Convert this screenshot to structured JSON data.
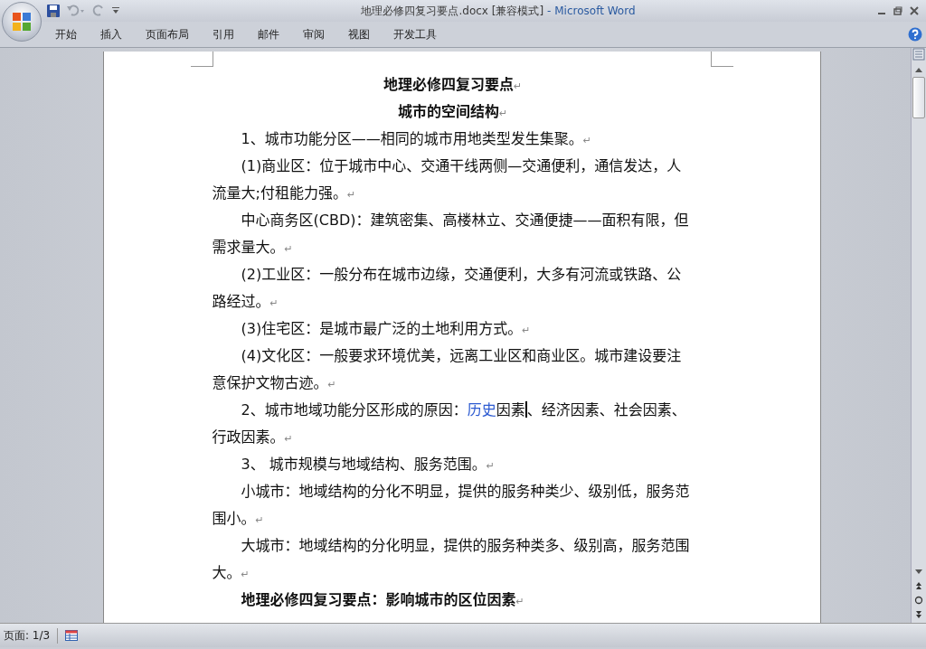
{
  "window": {
    "title": "地理必修四复习要点.docx [兼容模式]",
    "app_name": "- Microsoft Word"
  },
  "ribbon_tabs": [
    {
      "label": "开始",
      "selected": false
    },
    {
      "label": "插入",
      "selected": false
    },
    {
      "label": "页面布局",
      "selected": false
    },
    {
      "label": "引用",
      "selected": false
    },
    {
      "label": "邮件",
      "selected": false
    },
    {
      "label": "审阅",
      "selected": false
    },
    {
      "label": "视图",
      "selected": false
    },
    {
      "label": "开发工具",
      "selected": false
    }
  ],
  "document": {
    "paragraphs": [
      {
        "kind": "heading",
        "mark": "↵",
        "segments": [
          {
            "kind": "plain",
            "text": "地理必修四复习要点"
          }
        ]
      },
      {
        "kind": "heading",
        "mark": "↵",
        "segments": [
          {
            "kind": "plain",
            "text": "城市的空间结构"
          }
        ]
      },
      {
        "kind": "body",
        "mark": "↵",
        "segments": [
          {
            "kind": "plain",
            "text": "1、城市功能分区——相同的城市用地类型发生集聚。"
          }
        ]
      },
      {
        "kind": "body",
        "mark": "↵",
        "segments": [
          {
            "kind": "plain",
            "text": "(1)商业区：位于城市中心、交通干线两侧—交通便利，通信发达，人流量大;付租能力强。"
          }
        ]
      },
      {
        "kind": "body",
        "mark": "↵",
        "segments": [
          {
            "kind": "plain",
            "text": "中心商务区(CBD)：建筑密集、高楼林立、交通便捷——面积有限，但需求量大。"
          }
        ]
      },
      {
        "kind": "body",
        "mark": "↵",
        "segments": [
          {
            "kind": "plain",
            "text": "(2)工业区：一般分布在城市边缘，交通便利，大多有河流或铁路、公路经过。"
          }
        ]
      },
      {
        "kind": "body",
        "mark": "↵",
        "segments": [
          {
            "kind": "plain",
            "text": "(3)住宅区：是城市最广泛的土地利用方式。"
          }
        ]
      },
      {
        "kind": "body",
        "mark": "↵",
        "segments": [
          {
            "kind": "plain",
            "text": "(4)文化区：一般要求环境优美，远离工业区和商业区。城市建设要注意保护文物古迹。"
          }
        ]
      },
      {
        "kind": "body",
        "mark": "↵",
        "segments": [
          {
            "kind": "plain",
            "text": "2、城市地域功能分区形成的原因："
          },
          {
            "kind": "link",
            "text": "历史"
          },
          {
            "kind": "plain",
            "text": "因素"
          },
          {
            "kind": "cursor"
          },
          {
            "kind": "plain",
            "text": "、经济因素、社会因素、行政因素。"
          }
        ]
      },
      {
        "kind": "body",
        "mark": "↵",
        "segments": [
          {
            "kind": "plain",
            "text": "3、 城市规模与地域结构、服务范围。"
          }
        ]
      },
      {
        "kind": "body",
        "mark": "↵",
        "segments": [
          {
            "kind": "plain",
            "text": "小城市：地域结构的分化不明显，提供的服务种类少、级别低，服务范围小。"
          }
        ]
      },
      {
        "kind": "body",
        "mark": "↵",
        "segments": [
          {
            "kind": "plain",
            "text": "大城市：地域结构的分化明显，提供的服务种类多、级别高，服务范围大。"
          }
        ]
      },
      {
        "kind": "bold",
        "mark": "↵",
        "segments": [
          {
            "kind": "plain",
            "text": "地理必修四复习要点：影响城市的区位因素"
          }
        ]
      }
    ]
  },
  "status_bar": {
    "page": "页面: 1/3"
  }
}
